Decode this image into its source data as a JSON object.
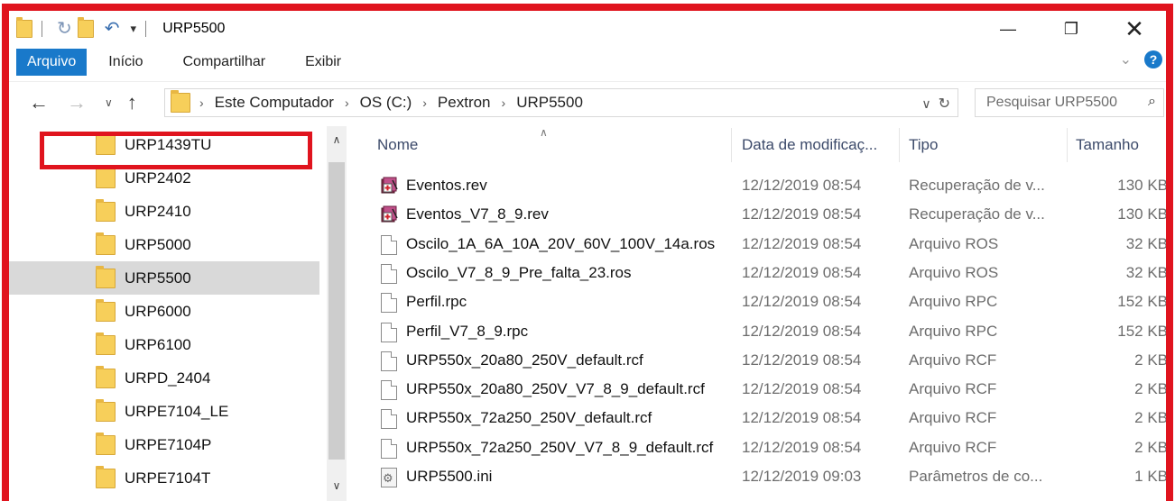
{
  "window": {
    "title": "URP5500",
    "minimize_glyph": "—",
    "restore_glyph": "❐",
    "close_glyph": "✕"
  },
  "ribbon": {
    "tabs": [
      {
        "label": "Arquivo"
      },
      {
        "label": "Início"
      },
      {
        "label": "Compartilhar"
      },
      {
        "label": "Exibir"
      }
    ],
    "help_label": "?"
  },
  "address": {
    "breadcrumbs": [
      "Este Computador",
      "OS (C:)",
      "Pextron",
      "URP5500"
    ],
    "search_placeholder": "Pesquisar URP5500"
  },
  "navpane": {
    "items": [
      {
        "label": "URP1439TU"
      },
      {
        "label": "URP2402"
      },
      {
        "label": "URP2410"
      },
      {
        "label": "URP5000"
      },
      {
        "label": "URP5500"
      },
      {
        "label": "URP6000"
      },
      {
        "label": "URP6100"
      },
      {
        "label": "URPD_2404"
      },
      {
        "label": "URPE7104_LE"
      },
      {
        "label": "URPE7104P"
      },
      {
        "label": "URPE7104T"
      }
    ],
    "selected": "URP5500"
  },
  "listview": {
    "columns": {
      "name": "Nome",
      "date": "Data de modificaç...",
      "type": "Tipo",
      "size": "Tamanho"
    },
    "rows": [
      {
        "icon": "rev-file-icon",
        "name": "Eventos.rev",
        "date": "12/12/2019 08:54",
        "type": "Recuperação de v...",
        "size": "130 KB"
      },
      {
        "icon": "rev-file-icon",
        "name": "Eventos_V7_8_9.rev",
        "date": "12/12/2019 08:54",
        "type": "Recuperação de v...",
        "size": "130 KB"
      },
      {
        "icon": "document-icon",
        "name": "Oscilo_1A_6A_10A_20V_60V_100V_14a.ros",
        "date": "12/12/2019 08:54",
        "type": "Arquivo ROS",
        "size": "32 KB"
      },
      {
        "icon": "document-icon",
        "name": "Oscilo_V7_8_9_Pre_falta_23.ros",
        "date": "12/12/2019 08:54",
        "type": "Arquivo ROS",
        "size": "32 KB"
      },
      {
        "icon": "document-icon",
        "name": "Perfil.rpc",
        "date": "12/12/2019 08:54",
        "type": "Arquivo RPC",
        "size": "152 KB"
      },
      {
        "icon": "document-icon",
        "name": "Perfil_V7_8_9.rpc",
        "date": "12/12/2019 08:54",
        "type": "Arquivo RPC",
        "size": "152 KB"
      },
      {
        "icon": "document-icon",
        "name": "URP550x_20a80_250V_default.rcf",
        "date": "12/12/2019 08:54",
        "type": "Arquivo RCF",
        "size": "2 KB"
      },
      {
        "icon": "document-icon",
        "name": "URP550x_20a80_250V_V7_8_9_default.rcf",
        "date": "12/12/2019 08:54",
        "type": "Arquivo RCF",
        "size": "2 KB"
      },
      {
        "icon": "document-icon",
        "name": "URP550x_72a250_250V_default.rcf",
        "date": "12/12/2019 08:54",
        "type": "Arquivo RCF",
        "size": "2 KB"
      },
      {
        "icon": "document-icon",
        "name": "URP550x_72a250_250V_V7_8_9_default.rcf",
        "date": "12/12/2019 08:54",
        "type": "Arquivo RCF",
        "size": "2 KB"
      },
      {
        "icon": "settings-file-icon",
        "name": "URP5500.ini",
        "date": "12/12/2019 09:03",
        "type": "Parâmetros de co...",
        "size": "1 KB"
      }
    ]
  },
  "colors": {
    "accent": "#1979ca",
    "annotation_red": "#e0141e",
    "folder": "#f7cf5a",
    "selection": "#d9d9d9"
  }
}
